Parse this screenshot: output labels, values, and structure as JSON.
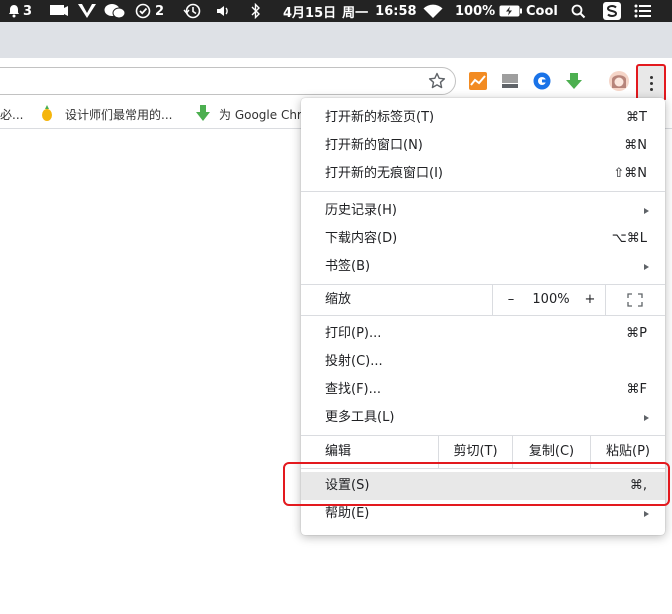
{
  "menubar": {
    "notif_count": "3",
    "check_count": "2",
    "date": "4月15日",
    "weekday": "周一",
    "time": "16:58",
    "battery": "100%",
    "user": "Cool"
  },
  "bookmarks": [
    {
      "label": "必..."
    },
    {
      "label": "设计师们最常用的..."
    },
    {
      "label": "为 Google Chro"
    }
  ],
  "menu": {
    "new_tab": {
      "label": "打开新的标签页(T)",
      "shortcut": "⌘T"
    },
    "new_window": {
      "label": "打开新的窗口(N)",
      "shortcut": "⌘N"
    },
    "new_incognito": {
      "label": "打开新的无痕窗口(I)",
      "shortcut": "⇧⌘N"
    },
    "history": {
      "label": "历史记录(H)"
    },
    "downloads": {
      "label": "下载内容(D)",
      "shortcut": "⌥⌘L"
    },
    "bookmarks": {
      "label": "书签(B)"
    },
    "zoom": {
      "label": "缩放",
      "minus": "–",
      "value": "100%",
      "plus": "+"
    },
    "print": {
      "label": "打印(P)...",
      "shortcut": "⌘P"
    },
    "cast": {
      "label": "投射(C)..."
    },
    "find": {
      "label": "查找(F)...",
      "shortcut": "⌘F"
    },
    "more_tools": {
      "label": "更多工具(L)"
    },
    "edit": {
      "label": "编辑",
      "cut": "剪切(T)",
      "copy": "复制(C)",
      "paste": "粘贴(P)"
    },
    "settings": {
      "label": "设置(S)",
      "shortcut": "⌘,"
    },
    "help": {
      "label": "帮助(E)"
    }
  },
  "colors": {
    "highlight_box": "#e3191e",
    "menu_hover": "#e8e8e8"
  }
}
